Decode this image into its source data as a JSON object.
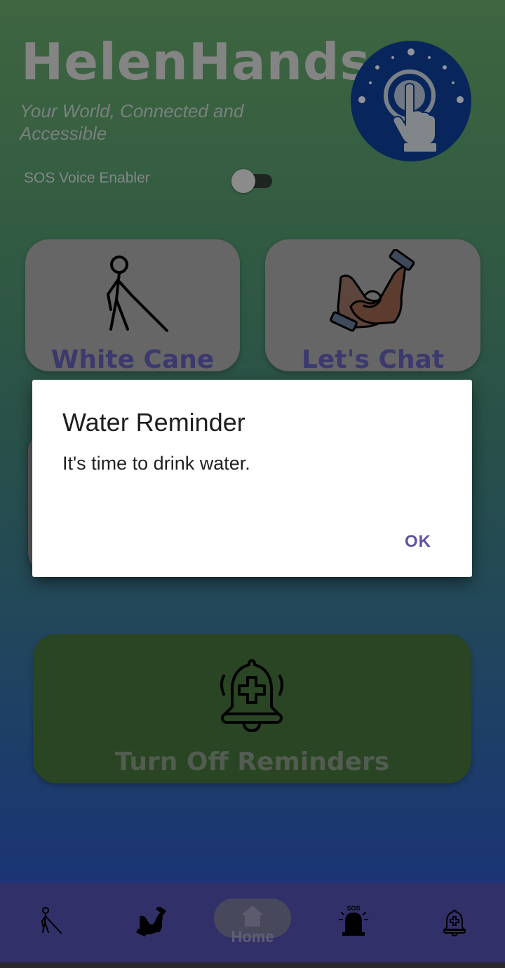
{
  "app": {
    "title": "HelenHands",
    "subtitle": "Your World, Connected and Accessible"
  },
  "sos_voice": {
    "label": "SOS Voice Enabler",
    "enabled": false
  },
  "cards": {
    "white_cane": {
      "label": "White Cane",
      "icon": "white-cane-person-icon"
    },
    "lets_chat": {
      "label": "Let's Chat",
      "icon": "sign-language-hands-icon"
    },
    "reminders": {
      "label": "Turn Off Reminders",
      "icon": "medical-alarm-bell-icon"
    }
  },
  "dialog": {
    "title": "Water Reminder",
    "message": "It's time to drink water.",
    "ok_label": "OK"
  },
  "bottom_nav": {
    "items": [
      {
        "label": "",
        "icon": "white-cane-person-icon"
      },
      {
        "label": "",
        "icon": "sign-language-hands-icon"
      },
      {
        "label": "Home",
        "icon": "home-icon"
      },
      {
        "label": "",
        "icon": "sos-siren-icon"
      },
      {
        "label": "",
        "icon": "medical-alarm-bell-icon"
      }
    ],
    "sos_badge": "SOS"
  },
  "colors": {
    "accent": "#5e52a8",
    "nav_bg": "#4b4a9f",
    "logo_bg": "#0d3a8c",
    "reminder_card": "#3f6a36"
  }
}
